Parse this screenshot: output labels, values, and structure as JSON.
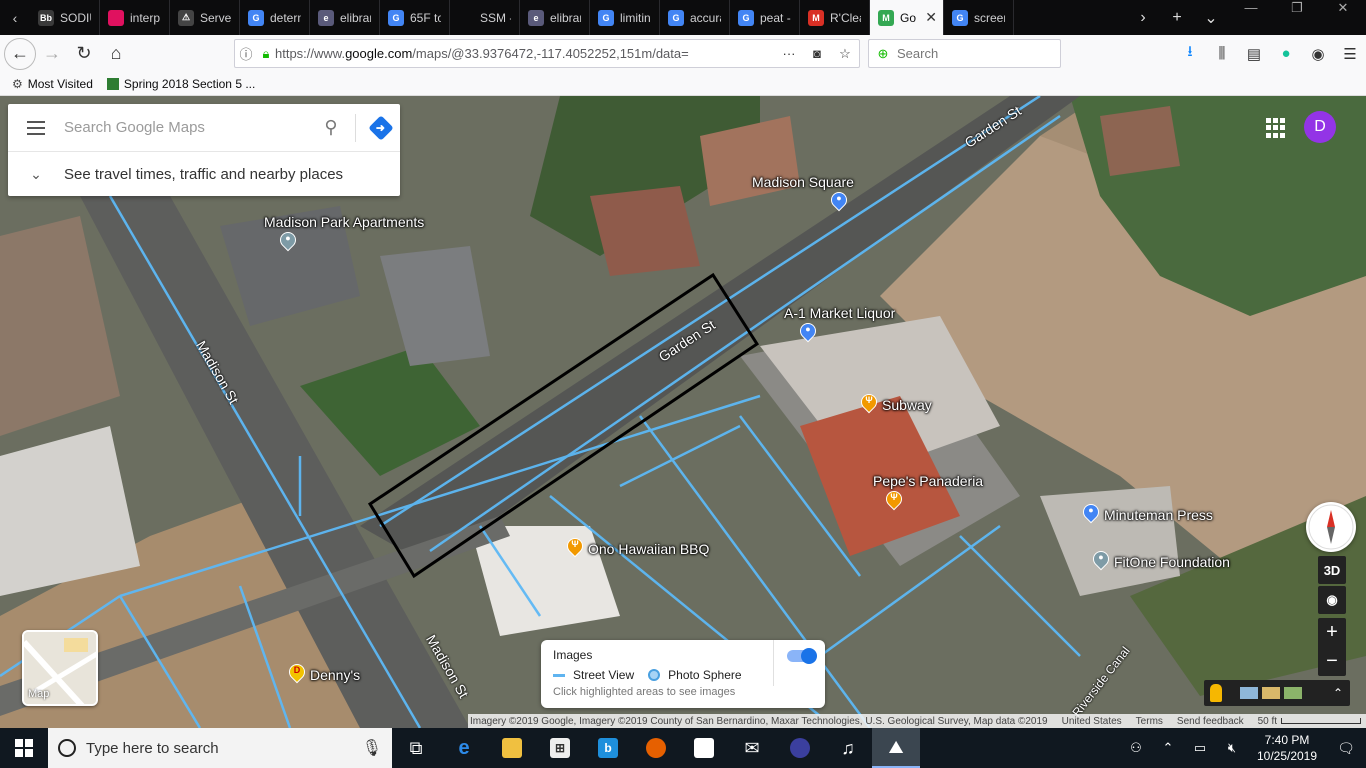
{
  "browser": {
    "tabs": [
      {
        "label": "SODIU",
        "favicon": "Bb",
        "color": "#3a3a3a"
      },
      {
        "label": "interp",
        "favicon": "",
        "color": "#e0115f"
      },
      {
        "label": "Server",
        "favicon": "⚠",
        "color": "#444"
      },
      {
        "label": "determ",
        "favicon": "G",
        "color": "#4285f4"
      },
      {
        "label": "elibrar",
        "favicon": "e",
        "color": "#5a5a7a"
      },
      {
        "label": "65F to",
        "favicon": "G",
        "color": "#4285f4"
      },
      {
        "label": "SSM - Ch.",
        "favicon": "",
        "color": "#0c0c0d"
      },
      {
        "label": "elibrar",
        "favicon": "e",
        "color": "#5a5a7a"
      },
      {
        "label": "limitin",
        "favicon": "G",
        "color": "#4285f4"
      },
      {
        "label": "accura",
        "favicon": "G",
        "color": "#4285f4"
      },
      {
        "label": "peat -",
        "favicon": "G",
        "color": "#4285f4"
      },
      {
        "label": "R'Clea",
        "favicon": "M",
        "color": "#d93025"
      },
      {
        "label": "Go",
        "favicon": "M",
        "color": "#34a853",
        "active": true
      },
      {
        "label": "screen",
        "favicon": "G",
        "color": "#4285f4"
      }
    ],
    "url_prefix": "https://www.",
    "url_domain": "google.com",
    "url_rest": "/maps/@33.9376472,-117.4052252,151m/data=",
    "search_placeholder": "Search",
    "bookmarks": [
      {
        "label": "Most Visited",
        "icon": "gear-icon"
      },
      {
        "label": "Spring 2018 Section 5 ...",
        "icon": "sheet-icon"
      }
    ]
  },
  "maps": {
    "search_placeholder": "Search Google Maps",
    "hint": "See travel times, traffic and nearby places",
    "avatar_letter": "D",
    "pois": [
      {
        "label": "Madison Square",
        "kind": "shopping"
      },
      {
        "label": "Madison Park Apartments",
        "kind": "residential"
      },
      {
        "label": "A-1 Market Liquor",
        "kind": "shopping"
      },
      {
        "label": "Subway",
        "kind": "restaurant"
      },
      {
        "label": "Pepe's Panaderia",
        "kind": "restaurant"
      },
      {
        "label": "Minuteman Press",
        "kind": "shopping"
      },
      {
        "label": "FitOne Foundation",
        "kind": "place"
      },
      {
        "label": "Ono Hawaiian BBQ",
        "kind": "restaurant"
      },
      {
        "label": "Denny's",
        "kind": "restaurant"
      }
    ],
    "streets": [
      "Garden St",
      "Garden St",
      "Madison St",
      "Madison St",
      "Riverside Canal"
    ],
    "minimap_label": "Map",
    "images_panel": {
      "title": "Images",
      "street_view": "Street View",
      "photo_sphere": "Photo Sphere",
      "hint": "Click highlighted areas to see images",
      "toggle_on": true
    },
    "controls": {
      "three_d": "3D",
      "zoom_in": "+",
      "zoom_out": "−"
    },
    "attribution": "Imagery ©2019 Google, Imagery ©2019 County of San Bernardino, Maxar Technologies, U.S. Geological Survey, Map data ©2019",
    "footer_links": [
      "United States",
      "Terms",
      "Send feedback"
    ],
    "scale_label": "50 ft"
  },
  "taskbar": {
    "search_placeholder": "Type here to search",
    "time": "7:40 PM",
    "date": "10/25/2019"
  }
}
